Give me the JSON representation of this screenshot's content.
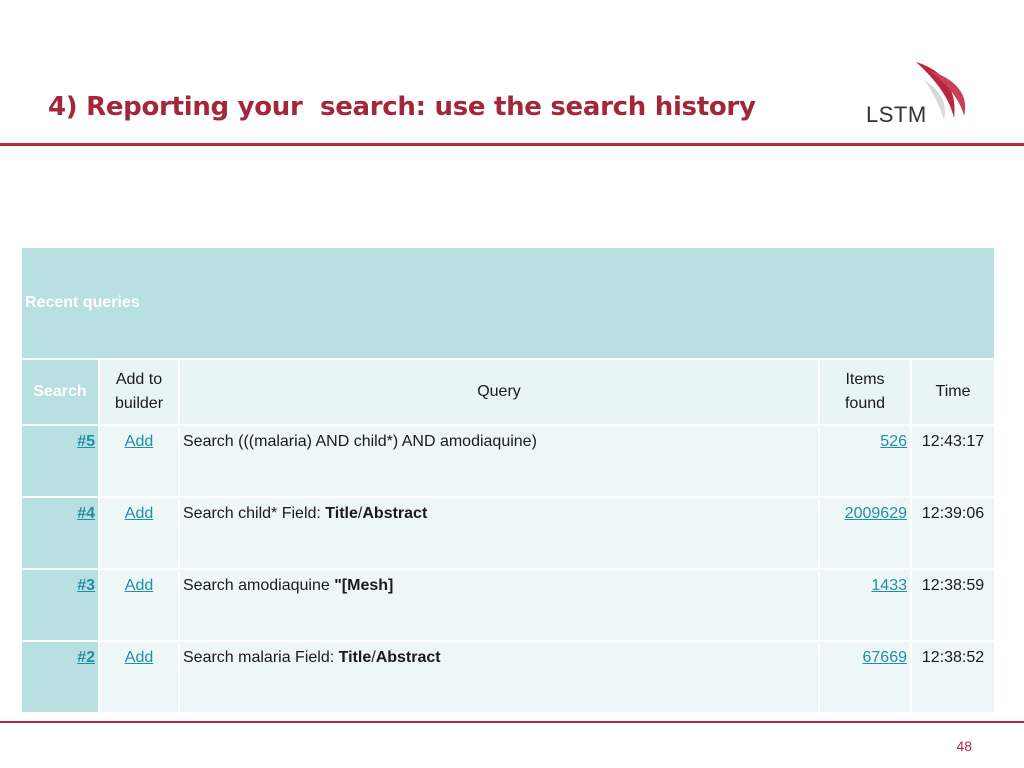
{
  "slide": {
    "title": "4) Reporting your  search: use the search history",
    "page_number": "48"
  },
  "logo": {
    "text": "LSTM",
    "color": "#b8273f"
  },
  "colors": {
    "accent": "#b8273f",
    "table_header": "#b8dfe1",
    "row_bg": "#eef7f7",
    "link": "#1f8fa5"
  },
  "table": {
    "caption": "Recent queries",
    "headers": {
      "search": "Search",
      "add_line1": "Add to",
      "add_line2": "builder",
      "query": "Query",
      "items_line1": "Items",
      "items_line2": "found",
      "time": "Time"
    },
    "rows": [
      {
        "search": "#5",
        "add": "Add",
        "query_prefix": "Search (((malaria) AND child*) AND amodiaquine)",
        "q_bold1": "",
        "q_sep": "",
        "q_bold2": "",
        "items": "526",
        "time": "12:43:17"
      },
      {
        "search": "#4",
        "add": "Add",
        "query_prefix": "Search child* Field: ",
        "q_bold1": "Title",
        "q_sep": "/",
        "q_bold2": "Abstract",
        "items": "2009629",
        "time": "12:39:06"
      },
      {
        "search": "#3",
        "add": "Add",
        "query_prefix": "Search amodiaquine ",
        "q_bold1": "\"[Mesh]",
        "q_sep": "",
        "q_bold2": "",
        "items": "1433",
        "time": "12:38:59"
      },
      {
        "search": "#2",
        "add": "Add",
        "query_prefix": "Search malaria Field: ",
        "q_bold1": "Title",
        "q_sep": "/",
        "q_bold2": "Abstract",
        "items": "67669",
        "time": "12:38:52"
      }
    ]
  }
}
